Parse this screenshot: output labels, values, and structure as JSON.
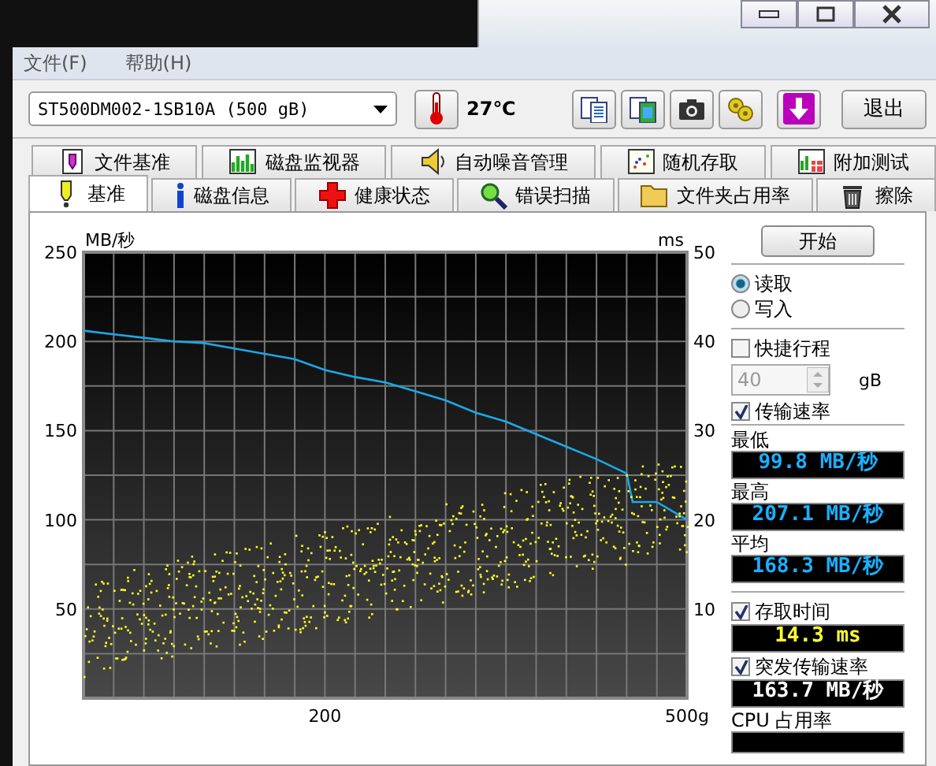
{
  "menu": [
    {
      "label": "文件(F)"
    },
    {
      "label": "帮助(H)"
    }
  ],
  "toolbar": {
    "drive": "ST500DM002-1SB10A (500 gB)",
    "temperature": "27℃",
    "exit_button": "退出"
  },
  "tabs_top": [
    {
      "label": "文件基准",
      "selected": false
    },
    {
      "label": "磁盘监视器",
      "selected": false
    },
    {
      "label": "自动噪音管理",
      "selected": false
    },
    {
      "label": "随机存取",
      "selected": false
    },
    {
      "label": "附加测试",
      "selected": false
    }
  ],
  "tabs_bottom": [
    {
      "label": "基准",
      "selected": true
    },
    {
      "label": "磁盘信息",
      "selected": false
    },
    {
      "label": "健康状态",
      "selected": false
    },
    {
      "label": "错误扫描",
      "selected": false
    },
    {
      "label": "文件夹占用率",
      "selected": false
    },
    {
      "label": "擦除",
      "selected": false
    }
  ],
  "chart": {
    "chart_data": {
      "type": "line",
      "ylabel": "MB/秒",
      "y2label": "ms",
      "grid": true,
      "xlim": [
        0,
        500
      ],
      "ylim": [
        0,
        250
      ],
      "y2lim": [
        0,
        50
      ],
      "yticks": [
        50,
        100,
        150,
        200,
        250
      ],
      "y2ticks": [
        10,
        20,
        30,
        40,
        50
      ],
      "xticks": [
        200,
        {
          "value": 500,
          "label": "500g"
        }
      ],
      "x": [
        0,
        25,
        50,
        75,
        100,
        125,
        150,
        175,
        200,
        225,
        250,
        275,
        300,
        325,
        350,
        375,
        400,
        425,
        450,
        455,
        475,
        500
      ],
      "series": [
        {
          "color": "#1aa8e8",
          "values": [
            206,
            204,
            202,
            200,
            199,
            196,
            193,
            190,
            184,
            180,
            177,
            172,
            167,
            160,
            155,
            148,
            141,
            134,
            126,
            110,
            110,
            100
          ]
        }
      ]
    }
  },
  "controls": {
    "start_button": "开始",
    "modes": [
      {
        "label": "读取",
        "selected": true
      },
      {
        "label": "写入",
        "selected": false
      }
    ],
    "short_stroke": {
      "label": "快捷行程",
      "checked": false
    },
    "stroke_field": {
      "value": "40",
      "unit": "gB",
      "disabled": true
    },
    "transfer_rate": {
      "label": "传输速率",
      "checked": true
    },
    "readouts": [
      {
        "label": "最低",
        "value": "99.8 MB/秒",
        "color": "#1ab0ff"
      },
      {
        "label": "最高",
        "value": "207.1 MB/秒",
        "color": "#1ab0ff"
      },
      {
        "label": "平均",
        "value": "168.3 MB/秒",
        "color": "#1ab0ff"
      }
    ],
    "access_time": {
      "label": "存取时间",
      "checked": true,
      "value": "14.3 ms",
      "color": "#ffff33"
    },
    "burst_rate": {
      "label": "突发传输速率",
      "checked": true,
      "value": "163.7 MB/秒",
      "color": "#ffffff"
    },
    "cpu_label": "CPU 占用率"
  }
}
